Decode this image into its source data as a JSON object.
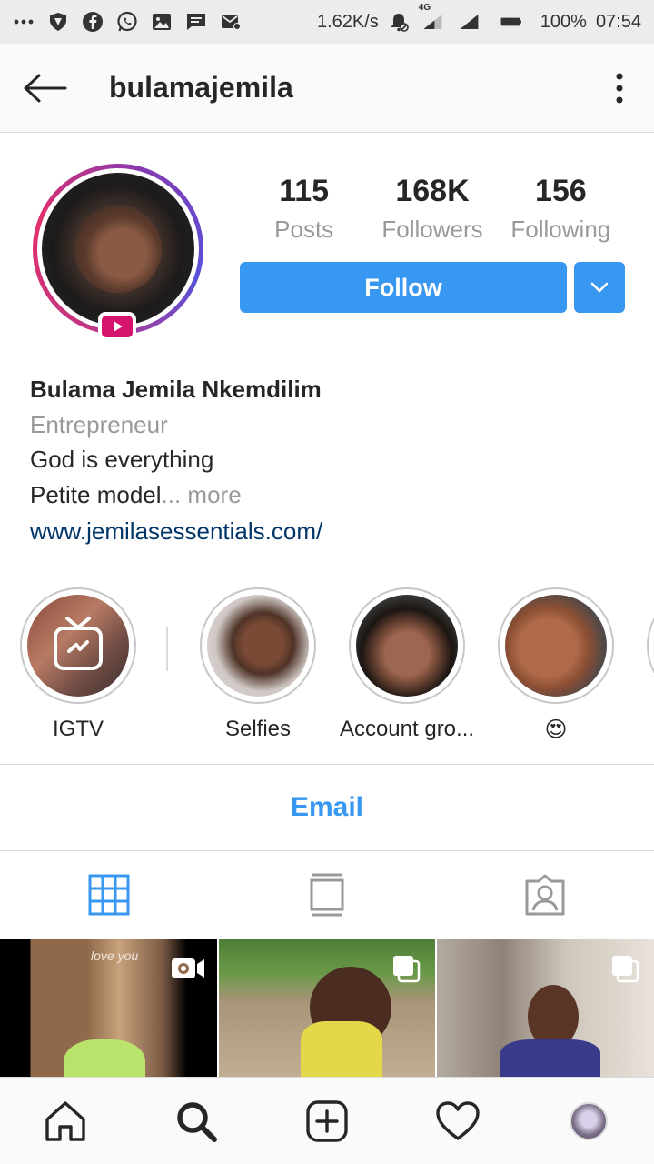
{
  "status_bar": {
    "net_speed": "1.62K/s",
    "network": "4G",
    "battery": "100%",
    "time": "07:54",
    "icons": [
      "more-icon",
      "vpn-shield-icon",
      "facebook-icon",
      "whatsapp-icon",
      "gallery-icon",
      "message-icon",
      "mail-icon",
      "mute-bell-icon",
      "signal-icon",
      "battery-icon"
    ]
  },
  "header": {
    "username": "bulamajemila",
    "back_icon": "arrow-left-icon",
    "menu_icon": "more-vertical-icon"
  },
  "profile": {
    "stats": [
      {
        "number": "115",
        "label": "Posts"
      },
      {
        "number": "168K",
        "label": "Followers"
      },
      {
        "number": "156",
        "label": "Following"
      }
    ],
    "follow_label": "Follow",
    "accent": "#3897f0"
  },
  "bio": {
    "name": "Bulama Jemila Nkemdilim",
    "category": "Entrepreneur",
    "line1": "God is everything",
    "line2": "Petite model",
    "more": "... more",
    "link": "www.jemilasessentials.com/"
  },
  "highlights": [
    {
      "label": "IGTV"
    },
    {
      "label": "Selfies"
    },
    {
      "label": "Account gro..."
    },
    {
      "label": "😍"
    }
  ],
  "email_label": "Email",
  "tabs": [
    "grid-icon",
    "igtv-tab-icon",
    "tagged-icon"
  ],
  "posts": [
    {
      "overlay_text": "love you",
      "badge": "video-icon"
    },
    {
      "overlay_text": "",
      "badge": "carousel-icon"
    },
    {
      "overlay_text": "",
      "badge": "carousel-icon"
    }
  ],
  "bottom_nav": [
    "home-icon",
    "search-icon",
    "add-post-icon",
    "heart-icon",
    "profile-avatar"
  ]
}
